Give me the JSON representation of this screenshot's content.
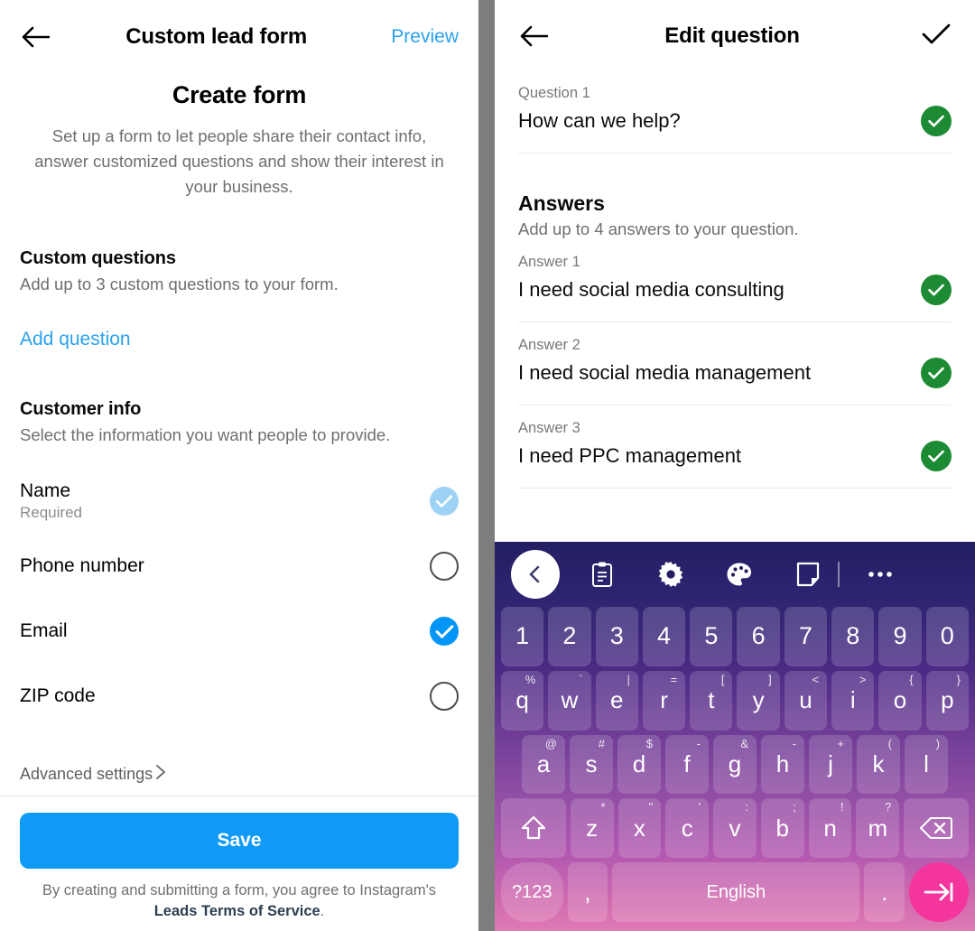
{
  "left_panel": {
    "header": {
      "back_icon": "back-arrow-icon",
      "title": "Custom lead form",
      "preview_label": "Preview"
    },
    "create_form": {
      "title": "Create form",
      "description": "Set up a form to let people share their contact info, answer customized questions and show their interest in your business."
    },
    "custom_questions": {
      "title": "Custom questions",
      "subtitle": "Add up to 3 custom questions to your form.",
      "add_question_label": "Add question"
    },
    "customer_info": {
      "title": "Customer info",
      "subtitle": "Select the information you want people to provide.",
      "items": [
        {
          "label": "Name",
          "sub": "Required",
          "state": "required-checked"
        },
        {
          "label": "Phone number",
          "sub": "",
          "state": "unchecked"
        },
        {
          "label": "Email",
          "sub": "",
          "state": "checked"
        },
        {
          "label": "ZIP code",
          "sub": "",
          "state": "unchecked"
        }
      ]
    },
    "advanced_settings_label": "Advanced settings",
    "advanced_settings_chevron": "chevron-right-icon",
    "save_label": "Save",
    "terms": {
      "prefix": "By creating and submitting a form, you agree to Instagram's ",
      "link": "Leads Terms of Service",
      "suffix": "."
    },
    "colors": {
      "accent_blue": "#0f9bf5",
      "link_blue": "#2aa2ef",
      "checkbox_on": "#0095f6",
      "checkbox_required": "#9ed2f5"
    }
  },
  "right_panel": {
    "header": {
      "back_icon": "back-arrow-icon",
      "title": "Edit question",
      "confirm_icon": "checkmark-icon"
    },
    "question": {
      "label": "Question 1",
      "value": "How can we help?",
      "status": "valid"
    },
    "answers_section": {
      "title": "Answers",
      "subtitle": "Add up to 4 answers to your question.",
      "items": [
        {
          "label": "Answer 1",
          "value": "I need social media consulting",
          "status": "valid"
        },
        {
          "label": "Answer 2",
          "value": "I need social media management",
          "status": "valid"
        },
        {
          "label": "Answer 3",
          "value": "I need PPC management",
          "status": "valid"
        }
      ]
    },
    "colors": {
      "valid_green": "#1d8b33"
    }
  },
  "keyboard": {
    "toolbar": [
      {
        "icon": "back-chevron-icon",
        "style": "circle"
      },
      {
        "icon": "clipboard-icon",
        "style": "plain"
      },
      {
        "icon": "gear-icon",
        "style": "plain"
      },
      {
        "icon": "palette-icon",
        "style": "plain"
      },
      {
        "icon": "sticker-note-icon",
        "style": "plain"
      },
      {
        "icon": "divider",
        "style": "sep"
      },
      {
        "icon": "more-options-icon",
        "style": "plain"
      }
    ],
    "rows": {
      "numbers": [
        "1",
        "2",
        "3",
        "4",
        "5",
        "6",
        "7",
        "8",
        "9",
        "0"
      ],
      "row1": [
        {
          "key": "q",
          "sup": "%"
        },
        {
          "key": "w",
          "sup": "`"
        },
        {
          "key": "e",
          "sup": "|"
        },
        {
          "key": "r",
          "sup": "="
        },
        {
          "key": "t",
          "sup": "["
        },
        {
          "key": "y",
          "sup": "]"
        },
        {
          "key": "u",
          "sup": "<"
        },
        {
          "key": "i",
          "sup": ">"
        },
        {
          "key": "o",
          "sup": "{"
        },
        {
          "key": "p",
          "sup": "}"
        }
      ],
      "row2": [
        {
          "key": "a",
          "sup": "@"
        },
        {
          "key": "s",
          "sup": "#"
        },
        {
          "key": "d",
          "sup": "$"
        },
        {
          "key": "f",
          "sup": "-"
        },
        {
          "key": "g",
          "sup": "&"
        },
        {
          "key": "h",
          "sup": "-"
        },
        {
          "key": "j",
          "sup": "+"
        },
        {
          "key": "k",
          "sup": "("
        },
        {
          "key": "l",
          "sup": ")"
        }
      ],
      "row3": [
        {
          "key": "z",
          "sup": "*"
        },
        {
          "key": "x",
          "sup": "\""
        },
        {
          "key": "c",
          "sup": "'"
        },
        {
          "key": "v",
          "sup": ":"
        },
        {
          "key": "b",
          "sup": ";"
        },
        {
          "key": "n",
          "sup": "!"
        },
        {
          "key": "m",
          "sup": "?"
        }
      ],
      "shift_icon": "shift-key-icon",
      "backspace_icon": "backspace-key-icon",
      "bottom": {
        "symbols_label": "?123",
        "comma": ",",
        "space_label": "English",
        "period": ".",
        "enter_icon": "enter-key-icon"
      }
    },
    "colors": {
      "gradient_top": "#231f63",
      "gradient_bottom": "#e07ab4",
      "enter_key": "#f5359e"
    }
  }
}
